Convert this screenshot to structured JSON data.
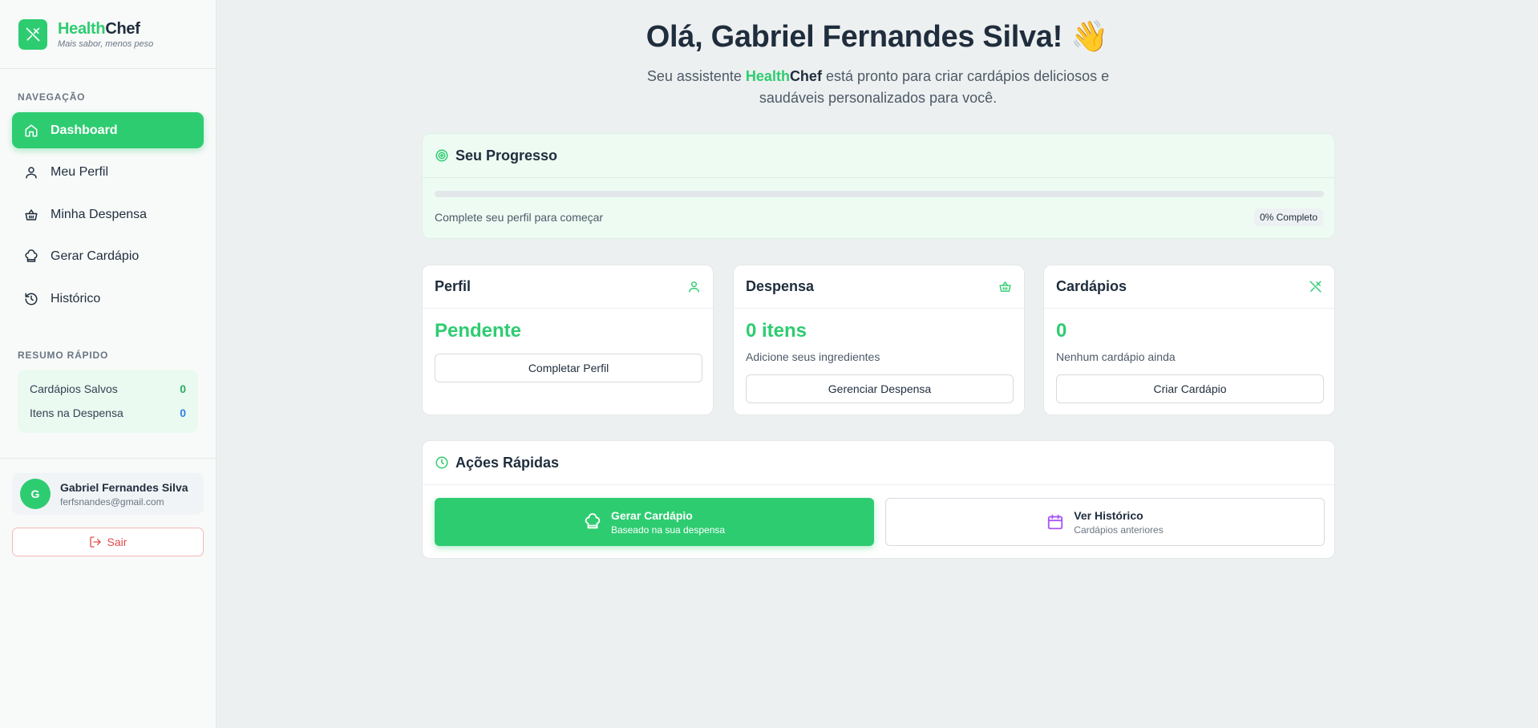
{
  "brand": {
    "name_part1": "Health",
    "name_part2": "Chef",
    "tagline": "Mais sabor, menos peso"
  },
  "sidebar": {
    "nav_label": "NAVEGAÇÃO",
    "items": [
      {
        "label": "Dashboard",
        "icon": "home-icon",
        "active": true
      },
      {
        "label": "Meu Perfil",
        "icon": "user-icon"
      },
      {
        "label": "Minha Despensa",
        "icon": "basket-icon"
      },
      {
        "label": "Gerar Cardápio",
        "icon": "chef-hat-icon"
      },
      {
        "label": "Histórico",
        "icon": "history-icon"
      }
    ],
    "summary_label": "RESUMO RÁPIDO",
    "summary": [
      {
        "label": "Cardápios Salvos",
        "value": "0"
      },
      {
        "label": "Itens na Despensa",
        "value": "0"
      }
    ]
  },
  "user": {
    "initial": "G",
    "name": "Gabriel Fernandes Silva",
    "email": "ferfsnandes@gmail.com",
    "logout_label": "Sair"
  },
  "main": {
    "greeting": "Olá, Gabriel Fernandes Silva! 👋",
    "intro_before": "Seu assistente ",
    "intro_brand1": "Health",
    "intro_brand2": "Chef",
    "intro_after": " está pronto para criar cardápios deliciosos e saudáveis personalizados para você."
  },
  "progress": {
    "title": "Seu Progresso",
    "percent": 0,
    "text": "Complete seu perfil para começar",
    "badge": "0% Completo"
  },
  "cards": [
    {
      "title": "Perfil",
      "value": "Pendente",
      "description": "",
      "button": "Completar Perfil",
      "icon": "user-icon"
    },
    {
      "title": "Despensa",
      "value": "0 itens",
      "description": "Adicione seus ingredientes",
      "button": "Gerenciar Despensa",
      "icon": "basket-icon"
    },
    {
      "title": "Cardápios",
      "value": "0",
      "description": "Nenhum cardápio ainda",
      "button": "Criar Cardápio",
      "icon": "utensils-icon"
    }
  ],
  "quick_actions": {
    "title": "Ações Rápidas",
    "primary": {
      "title": "Gerar Cardápio",
      "subtitle": "Baseado na sua despensa",
      "icon": "chef-hat-icon"
    },
    "secondary": {
      "title": "Ver Histórico",
      "subtitle": "Cardápios anteriores",
      "icon": "calendar-icon"
    }
  },
  "colors": {
    "accent": "#2ecc71",
    "danger": "#e24b4b",
    "info": "#2f80ed",
    "purple": "#a855f7"
  }
}
